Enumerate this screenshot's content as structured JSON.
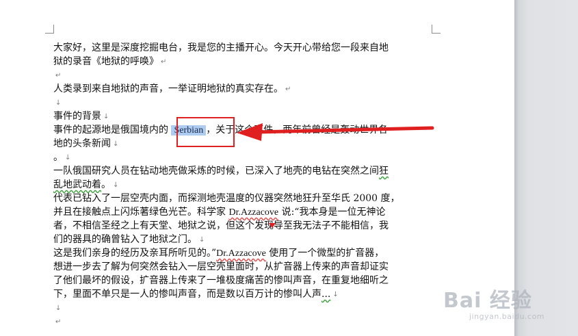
{
  "document": {
    "lines": [
      {
        "segments": [
          {
            "t": "大家好，这里是深度挖掘电台，我是您的主播开心。今天开心带给您一段来自地"
          }
        ],
        "mark": ""
      },
      {
        "segments": [
          {
            "t": "狱的录音《地狱的呼唤》"
          }
        ],
        "mark": "↵"
      },
      {
        "segments": [],
        "mark": "↵"
      },
      {
        "segments": [
          {
            "t": "人类录到来自地狱的声音，一举证明地狱的真实存在。"
          }
        ],
        "mark": "↵"
      },
      {
        "segments": [],
        "mark": "↓"
      },
      {
        "segments": [
          {
            "t": "事件的背景"
          }
        ],
        "mark": "↓"
      },
      {
        "segments": [
          {
            "t": "事件的起源地是俄国境内的 "
          },
          {
            "t": "Serbian",
            "cls": "sel"
          },
          {
            "t": "，关于这个事件，两年前曾经是轰动世界各"
          }
        ],
        "mark": ""
      },
      {
        "segments": [
          {
            "t": "地的头条新闻"
          }
        ],
        "mark": "↓"
      },
      {
        "segments": [
          {
            "t": "。"
          }
        ],
        "mark": "↓"
      },
      {
        "segments": [
          {
            "t": "一队俄国研究人员在钻动地壳做采炼的时候，已深入了地壳的电钻在突然之间"
          },
          {
            "t": "狂",
            "cls": "squig-g"
          }
        ],
        "mark": ""
      },
      {
        "segments": [
          {
            "t": "乱地武动着",
            "cls": "squig-g"
          },
          {
            "t": "。"
          }
        ],
        "mark": "↓"
      },
      {
        "segments": [
          {
            "t": "代表已钻入了一层空壳内面，而探测地壳温度的仪器突然地狂升至华氏 2000 度，"
          }
        ],
        "mark": ""
      },
      {
        "segments": [
          {
            "t": "并且在接触点上闪烁著绿色光芒。科学家 "
          },
          {
            "t": "Dr.Azzacove",
            "cls": "name squig"
          },
          {
            "t": " 说:“我本身是一位无神论"
          }
        ],
        "mark": ""
      },
      {
        "segments": [
          {
            "t": "者，不相信圣经之上有天堂、地狱之说，但这个发现导至我无法子不能相信，我"
          }
        ],
        "mark": ""
      },
      {
        "segments": [
          {
            "t": "们的器具的确曾钻入了地狱之门。"
          }
        ],
        "mark": "↓"
      },
      {
        "segments": [
          {
            "t": "这是我们亲身的经历及亲耳所听见的。”"
          },
          {
            "t": "Dr.Azzacove",
            "cls": "name squig"
          },
          {
            "t": " 使用了一个微型的扩音器，"
          }
        ],
        "mark": ""
      },
      {
        "segments": [
          {
            "t": "想进一步去了解为何突然会钻入一层空壳里面时，从扩音器上传来的声音却证实"
          }
        ],
        "mark": ""
      },
      {
        "segments": [
          {
            "t": "了他们最坏的假设，扩音器上传来了一堆极度痛苦的惨叫声音，在重复地细听之"
          }
        ],
        "mark": ""
      },
      {
        "segments": [
          {
            "t": "下，里面不单只是一人的惨叫声音，而是数以百万计的惨叫人声"
          },
          {
            "t": "...",
            "cls": "squig-g"
          }
        ],
        "mark": "↓"
      },
      {
        "segments": [],
        "mark": "↓"
      },
      {
        "segments": [],
        "mark": "↵"
      }
    ]
  },
  "watermark": {
    "main": "Bai 经验",
    "url": "jingyan.baidu.com"
  },
  "colors": {
    "selection": "#aecbf0",
    "annotation": "#e02020"
  }
}
